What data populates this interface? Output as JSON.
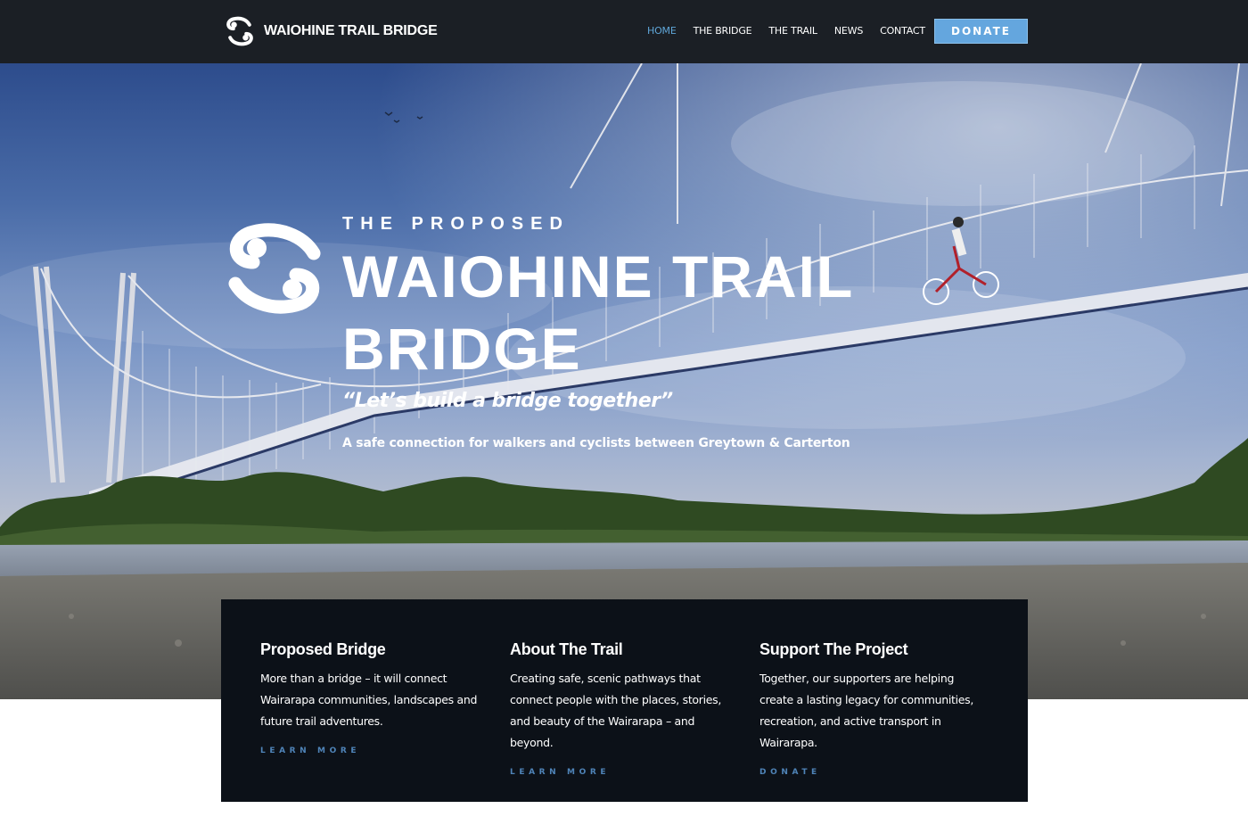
{
  "header": {
    "site_name": "WAIOHINE TRAIL BRIDGE",
    "nav": [
      {
        "label": "HOME",
        "active": true
      },
      {
        "label": "THE BRIDGE",
        "active": false
      },
      {
        "label": "THE TRAIL",
        "active": false
      },
      {
        "label": "NEWS",
        "active": false
      },
      {
        "label": "CONTACT",
        "active": false
      }
    ],
    "donate_label": "DONATE"
  },
  "hero": {
    "kicker": "THE PROPOSED",
    "title": "WAIOHINE TRAIL BRIDGE",
    "tagline": "“Let’s build a bridge together”",
    "subtitle": "A safe connection for walkers and cyclists between Greytown & Carterton"
  },
  "features": [
    {
      "title": "Proposed Bridge",
      "body": "More than a bridge – it will connect Wairarapa communities, landscapes and future trail adventures.",
      "link": "LEARN MORE"
    },
    {
      "title": "About The Trail",
      "body": "Creating safe, scenic pathways that connect people with the places, stories, and beauty of the Wairarapa – and beyond.",
      "link": "LEARN MORE"
    },
    {
      "title": "Support The Project",
      "body": "Together, our supporters are helping create a lasting legacy for communities, recreation, and active transport in Wairarapa.",
      "link": "DONATE"
    }
  ],
  "colors": {
    "header_bg": "#1b1f25",
    "accent": "#64a6de",
    "nav_active": "#5fa6d8",
    "panel_bg": "#0c1118",
    "link": "#4f84b8"
  }
}
